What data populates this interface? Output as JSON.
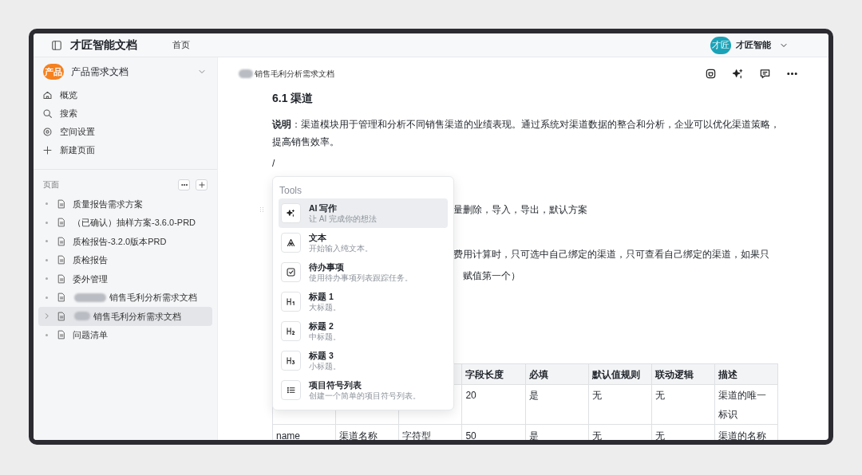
{
  "topbar": {
    "title": "才匠智能文档",
    "nav": "首页",
    "avatar": "才匠",
    "user": "才匠智能"
  },
  "sidebar": {
    "space": {
      "badge": "产品",
      "name": "产品需求文档"
    },
    "nav": [
      {
        "kind": "home",
        "label": "概览"
      },
      {
        "kind": "search",
        "label": "搜索"
      },
      {
        "kind": "settings",
        "label": "空间设置"
      },
      {
        "kind": "new",
        "label": "新建页面"
      }
    ],
    "pages_label": "页面",
    "pages": [
      {
        "label": "质量报告需求方案",
        "blurred_prefix": false,
        "has_children": false,
        "selected": false
      },
      {
        "label": "（已确认）抽样方案-3.6.0-PRD",
        "blurred_prefix": false,
        "has_children": false,
        "selected": false
      },
      {
        "label": "质检报告-3.2.0版本PRD",
        "blurred_prefix": false,
        "has_children": false,
        "selected": false
      },
      {
        "label": "质检报告",
        "blurred_prefix": false,
        "has_children": false,
        "selected": false
      },
      {
        "label": "委外管理",
        "blurred_prefix": false,
        "has_children": false,
        "selected": false
      },
      {
        "label": "销售毛利分析需求文档",
        "blurred_prefix": true,
        "has_children": false,
        "selected": false
      },
      {
        "label": "销售毛利分析需求文档",
        "blurred_prefix": true,
        "has_children": true,
        "selected": true
      },
      {
        "label": "问题清单",
        "blurred_prefix": false,
        "has_children": false,
        "selected": false
      }
    ]
  },
  "document": {
    "breadcrumb": {
      "text": "销售毛利分析需求文档",
      "blurred_prefix": true
    },
    "heading": "6.1 渠道",
    "description": "**说明**：渠道模块用于管理和分析不同销售渠道的业绩表现。通过系统对渠道数据的整合和分析，企业可以优化渠道策略，提高销售效率。",
    "typed": "/",
    "fragment_1": "量删除，导入，导出，默认方案",
    "fragment_2": [
      "费用计算时，只可选中自己绑定的渠道，只可查看自己绑定的渠道，如果只",
      "赋值第一个）"
    ],
    "table": {
      "columns": [
        "",
        "",
        "",
        "字段长度",
        "必填",
        "默认值规则",
        "联动逻辑",
        "描述"
      ],
      "rows": [
        [
          "",
          "",
          "",
          "20",
          "是",
          "无",
          "无",
          "渠道的唯一标识"
        ],
        [
          "name",
          "渠道名称",
          "字符型",
          "50",
          "是",
          "无",
          "无",
          "渠道的名称"
        ]
      ]
    }
  },
  "menu": {
    "title": "Tools",
    "items": [
      {
        "kind": "ai",
        "title": "AI 写作",
        "hint": "让 AI 完成你的想法",
        "selected": true
      },
      {
        "kind": "text",
        "title": "文本",
        "hint": "开始输入纯文本。",
        "selected": false
      },
      {
        "kind": "todo",
        "title": "待办事项",
        "hint": "使用待办事项列表跟踪任务。",
        "selected": false
      },
      {
        "kind": "h1",
        "title": "标题 1",
        "hint": "大标题。",
        "selected": false
      },
      {
        "kind": "h2",
        "title": "标题 2",
        "hint": "中标题。",
        "selected": false
      },
      {
        "kind": "h3",
        "title": "标题 3",
        "hint": "小标题。",
        "selected": false
      },
      {
        "kind": "bullet",
        "title": "项目符号列表",
        "hint": "创建一个简单的项目符号列表。",
        "selected": false
      }
    ]
  }
}
